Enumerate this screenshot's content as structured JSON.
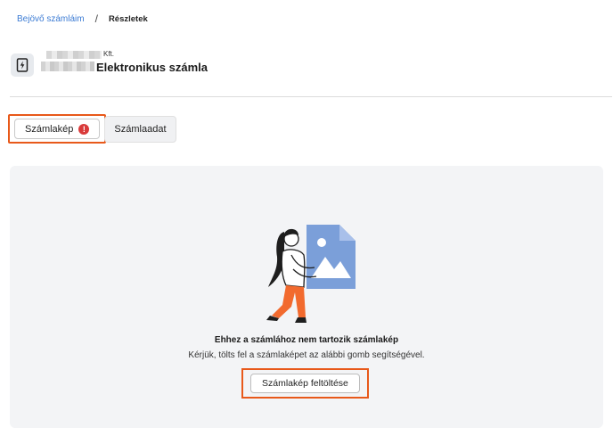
{
  "breadcrumb": {
    "parent": "Bejövő számláim",
    "separator": "/",
    "current": "Részletek"
  },
  "header": {
    "company_suffix": "Kft.",
    "title": "Elektronikus számla",
    "icon": "lightning-document-icon"
  },
  "tabs": [
    {
      "label": "Számlakép",
      "badge": "!",
      "active": true
    },
    {
      "label": "Számlaadat",
      "active": false
    }
  ],
  "empty_state": {
    "title": "Ehhez a számlához nem tartozik számlakép",
    "subtitle": "Kérjük, tölts fel a számlaképet az alábbi gomb segítségével.",
    "button_label": "Számlakép feltöltése"
  },
  "colors": {
    "link": "#3b7bd4",
    "highlight": "#e8591a",
    "alert": "#d93a3a",
    "illustration_doc": "#7b9fd9",
    "illustration_pants": "#f26a2e"
  }
}
